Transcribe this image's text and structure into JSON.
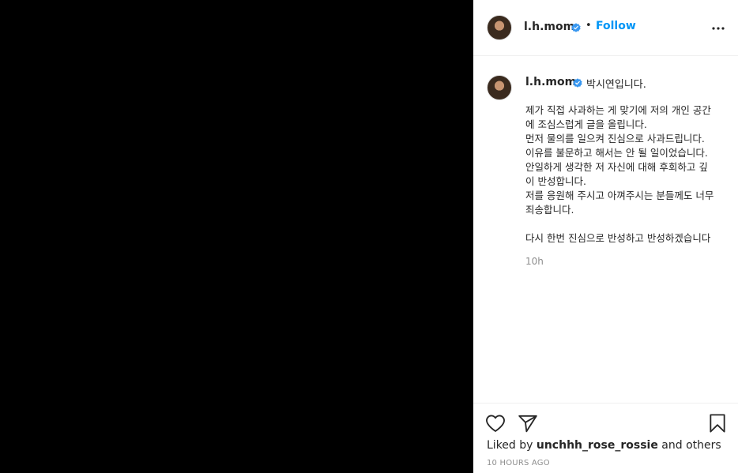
{
  "header": {
    "username": "l.h.mom",
    "separator": "•",
    "follow_label": "Follow"
  },
  "caption": {
    "username": "l.h.mom",
    "first_line": "박시연입니다.",
    "lines": [
      "제가 직접 사과하는 게 맞기에 저의 개인 공간",
      "에 조심스럽게 글을 올립니다.",
      "먼저 물의를 일으켜 진심으로 사과드립니다.",
      "이유를 불문하고 해서는 안 될 일이었습니다.",
      "안일하게 생각한 저 자신에 대해 후회하고 깊",
      "이 반성합니다.",
      "저를 응원해 주시고 아껴주시는 분들께도 너무",
      "죄송합니다.",
      "",
      "다시 한번 진심으로 반성하고 반성하겠습니다"
    ],
    "timestamp": "10h"
  },
  "footer": {
    "liked_by_prefix": "Liked by",
    "liker": "unchhh_rose_rossie",
    "and_others": "and others",
    "time_ago": "10 HOURS AGO"
  },
  "icons": {
    "verified": "verified-badge-icon",
    "more": "more-options-icon",
    "like": "heart-icon",
    "share": "paper-plane-icon",
    "save": "bookmark-icon"
  },
  "colors": {
    "link": "#0095f6",
    "text": "#262626",
    "muted": "#8e8e8e",
    "media_background": "#000000"
  }
}
